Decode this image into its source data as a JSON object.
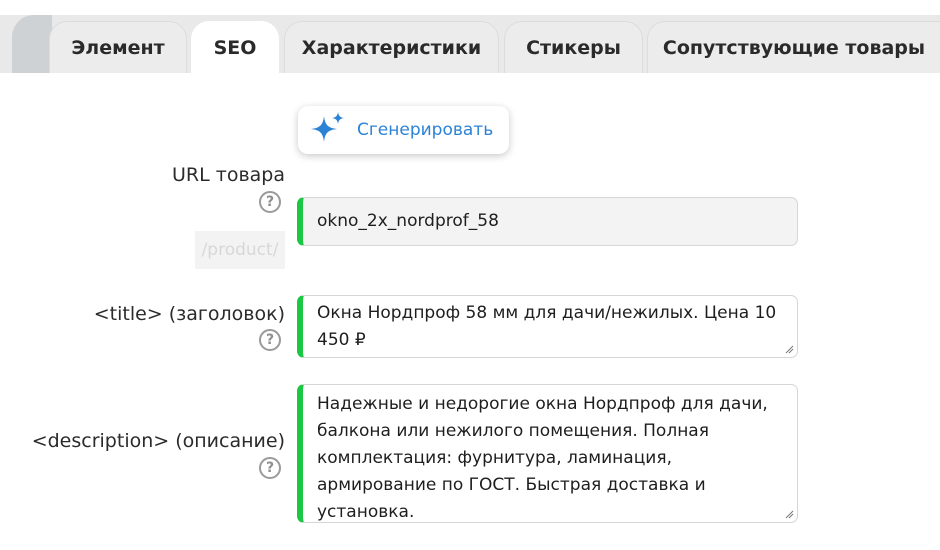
{
  "tabs": [
    {
      "label": "Элемент"
    },
    {
      "label": "SEO"
    },
    {
      "label": "Характеристики"
    },
    {
      "label": "Стикеры"
    },
    {
      "label": "Сопутствующие товары"
    }
  ],
  "active_tab": "SEO",
  "generate_button": {
    "label": "Сгенерировать",
    "icon": "sparkles-icon"
  },
  "fields": {
    "url": {
      "label": "URL товара",
      "prefix": "/product/",
      "value": "okno_2x_nordprof_58"
    },
    "title": {
      "label": "<title> (заголовок)",
      "value": "Окна Нордпроф 58 мм для дачи/нежилых. Цена 10 450 ₽"
    },
    "description": {
      "label": "<description> (описание)",
      "value": "Надежные и недорогие окна Нордпроф для дачи, балкона или нежилого помещения. Полная комплектация: фурнитура, ламинация, армирование по ГОСТ. Быстрая доставка и установка."
    }
  },
  "help_symbol": "?",
  "colors": {
    "accent_green": "#1cc744",
    "link_blue": "#2b83d6",
    "tab_bg": "#ececec"
  }
}
